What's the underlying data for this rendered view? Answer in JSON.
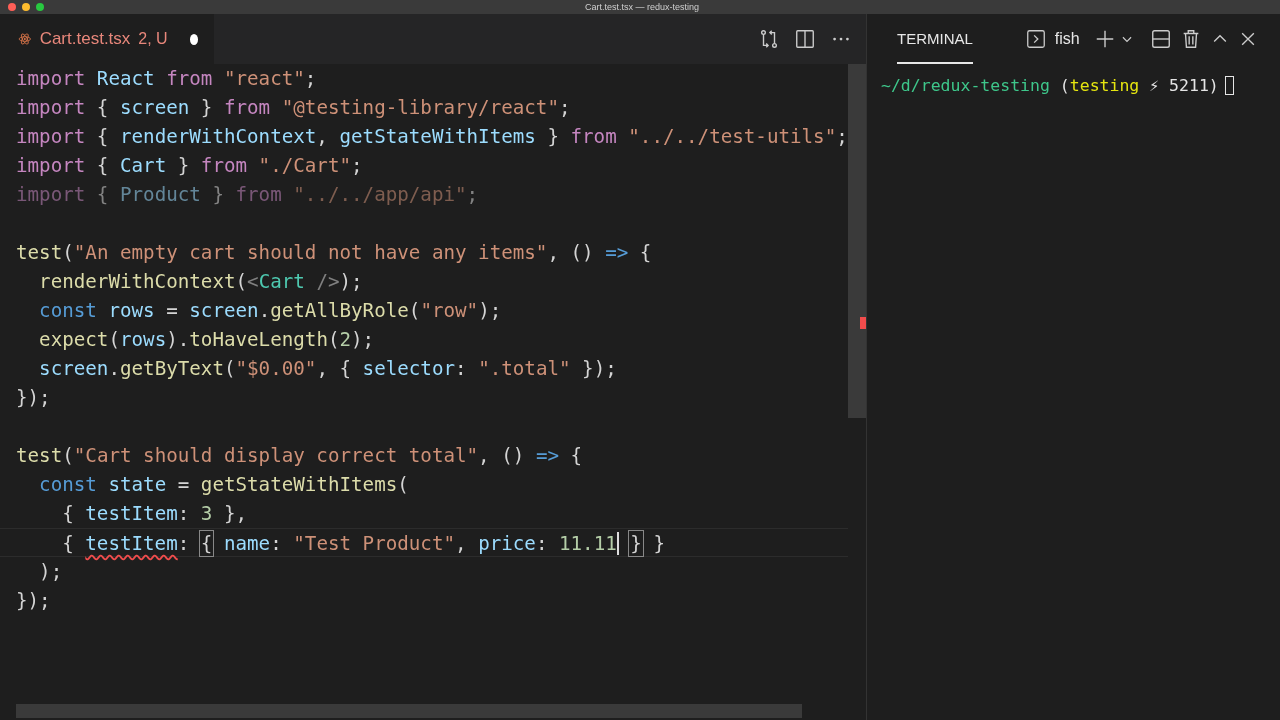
{
  "window": {
    "title": "Cart.test.tsx — redux-testing"
  },
  "editor": {
    "tab": {
      "label": "Cart.test.tsx",
      "status": "2, U",
      "modified": true,
      "selected": true
    },
    "blocks": [
      {
        "lines": [
          {
            "tokens": [
              {
                "kind": "kw",
                "text": "import"
              },
              {
                "kind": "var",
                "text": " React"
              },
              {
                "kind": "kw",
                "text": " from"
              },
              {
                "kind": "str",
                "text": " \"react\""
              },
              {
                "kind": "p",
                "text": ";"
              }
            ]
          },
          {
            "tokens": [
              {
                "kind": "kw",
                "text": "import"
              },
              {
                "kind": "p",
                "text": " {"
              },
              {
                "kind": "var",
                "text": " screen"
              },
              {
                "kind": "p",
                "text": " }"
              },
              {
                "kind": "kw",
                "text": " from"
              },
              {
                "kind": "str",
                "text": " \"@testing-library/react\""
              },
              {
                "kind": "p",
                "text": ";"
              }
            ]
          },
          {
            "tokens": [
              {
                "kind": "kw",
                "text": "import"
              },
              {
                "kind": "p",
                "text": " {"
              },
              {
                "kind": "var",
                "text": " renderWithContext"
              },
              {
                "kind": "p",
                "text": ","
              },
              {
                "kind": "var",
                "text": " getStateWithItems"
              },
              {
                "kind": "p",
                "text": " }"
              },
              {
                "kind": "kw",
                "text": " from"
              },
              {
                "kind": "str",
                "text": " \"../../test-utils\""
              },
              {
                "kind": "p",
                "text": ";"
              }
            ]
          },
          {
            "tokens": [
              {
                "kind": "kw",
                "text": "import"
              },
              {
                "kind": "p",
                "text": " {"
              },
              {
                "kind": "var",
                "text": " Cart"
              },
              {
                "kind": "p",
                "text": " }"
              },
              {
                "kind": "kw",
                "text": " from"
              },
              {
                "kind": "str",
                "text": " \"./Cart\""
              },
              {
                "kind": "p",
                "text": ";"
              }
            ]
          },
          {
            "dimmed": true,
            "tokens": [
              {
                "kind": "kw",
                "text": "import"
              },
              {
                "kind": "p",
                "text": " {"
              },
              {
                "kind": "var",
                "text": " Product"
              },
              {
                "kind": "p",
                "text": " }"
              },
              {
                "kind": "kw",
                "text": " from"
              },
              {
                "kind": "str",
                "text": " \"../../app/api\""
              },
              {
                "kind": "p",
                "text": ";"
              }
            ]
          }
        ]
      },
      {
        "lines": [
          {
            "tokens": [
              {
                "kind": "fn",
                "text": "test"
              },
              {
                "kind": "p",
                "text": "("
              },
              {
                "kind": "str",
                "text": "\"An empty cart should not have any items\""
              },
              {
                "kind": "p",
                "text": ", ()"
              },
              {
                "kind": "decl",
                "text": " =>"
              },
              {
                "kind": "p",
                "text": " {"
              }
            ]
          },
          {
            "tokens": [
              {
                "kind": "fn",
                "text": "  renderWithContext"
              },
              {
                "kind": "p",
                "text": "("
              },
              {
                "kind": "tag",
                "text": "<"
              },
              {
                "kind": "type",
                "text": "Cart"
              },
              {
                "kind": "tag",
                "text": " />"
              },
              {
                "kind": "p",
                "text": ");"
              }
            ]
          },
          {
            "tokens": [
              {
                "kind": "decl",
                "text": "  const"
              },
              {
                "kind": "var",
                "text": " rows"
              },
              {
                "kind": "p",
                "text": " ="
              },
              {
                "kind": "var",
                "text": " screen"
              },
              {
                "kind": "p",
                "text": "."
              },
              {
                "kind": "fn",
                "text": "getAllByRole"
              },
              {
                "kind": "p",
                "text": "("
              },
              {
                "kind": "str",
                "text": "\"row\""
              },
              {
                "kind": "p",
                "text": ");"
              }
            ]
          },
          {
            "tokens": [
              {
                "kind": "fn",
                "text": "  expect"
              },
              {
                "kind": "p",
                "text": "("
              },
              {
                "kind": "var",
                "text": "rows"
              },
              {
                "kind": "p",
                "text": ")."
              },
              {
                "kind": "fn",
                "text": "toHaveLength"
              },
              {
                "kind": "p",
                "text": "("
              },
              {
                "kind": "num",
                "text": "2"
              },
              {
                "kind": "p",
                "text": ");"
              }
            ]
          },
          {
            "tokens": [
              {
                "kind": "var",
                "text": "  screen"
              },
              {
                "kind": "p",
                "text": "."
              },
              {
                "kind": "fn",
                "text": "getByText"
              },
              {
                "kind": "p",
                "text": "("
              },
              {
                "kind": "str",
                "text": "\"$0.00\""
              },
              {
                "kind": "p",
                "text": ", {"
              },
              {
                "kind": "var",
                "text": " selector"
              },
              {
                "kind": "p",
                "text": ":"
              },
              {
                "kind": "str",
                "text": " \".total\""
              },
              {
                "kind": "p",
                "text": " });"
              }
            ]
          },
          {
            "tokens": [
              {
                "kind": "p",
                "text": "});"
              }
            ]
          }
        ]
      },
      {
        "lines": [
          {
            "tokens": [
              {
                "kind": "fn",
                "text": "test"
              },
              {
                "kind": "p",
                "text": "("
              },
              {
                "kind": "str",
                "text": "\"Cart should display correct total\""
              },
              {
                "kind": "p",
                "text": ", ()"
              },
              {
                "kind": "decl",
                "text": " =>"
              },
              {
                "kind": "p",
                "text": " {"
              }
            ]
          },
          {
            "tokens": [
              {
                "kind": "decl",
                "text": "  const"
              },
              {
                "kind": "var",
                "text": " state"
              },
              {
                "kind": "p",
                "text": " ="
              },
              {
                "kind": "fn",
                "text": " getStateWithItems"
              },
              {
                "kind": "p",
                "text": "("
              }
            ]
          },
          {
            "tokens": [
              {
                "kind": "p",
                "text": "    {"
              },
              {
                "kind": "var",
                "text": " testItem"
              },
              {
                "kind": "p",
                "text": ":"
              },
              {
                "kind": "num",
                "text": " 3"
              },
              {
                "kind": "p",
                "text": " },"
              }
            ]
          },
          {
            "current": true,
            "tokens": [
              {
                "kind": "p",
                "text": "    { "
              },
              {
                "kind": "var",
                "text": "testItem",
                "error": true
              },
              {
                "kind": "p",
                "text": ": "
              },
              {
                "kind": "p",
                "text": "{",
                "bracket_match": true
              },
              {
                "kind": "var",
                "text": " name"
              },
              {
                "kind": "p",
                "text": ":"
              },
              {
                "kind": "str",
                "text": " \"Test Product\""
              },
              {
                "kind": "p",
                "text": ","
              },
              {
                "kind": "var",
                "text": " price"
              },
              {
                "kind": "p",
                "text": ": "
              },
              {
                "kind": "num",
                "text": "11.11",
                "cursor": true
              },
              {
                "kind": "p",
                "text": "}",
                "bracket_match": true
              },
              {
                "kind": "p",
                "text": " }"
              }
            ]
          },
          {
            "tokens": [
              {
                "kind": "p",
                "text": "  );"
              }
            ]
          },
          {
            "tokens": [
              {
                "kind": "p",
                "text": "});"
              }
            ]
          }
        ]
      }
    ]
  },
  "terminal": {
    "tab": {
      "label": "TERMINAL",
      "selected": true
    },
    "shell": "fish",
    "prompt": {
      "path": "~/d/redux-testing",
      "open": " (",
      "branch": "testing",
      "rest": " ⚡ 5211)"
    }
  }
}
